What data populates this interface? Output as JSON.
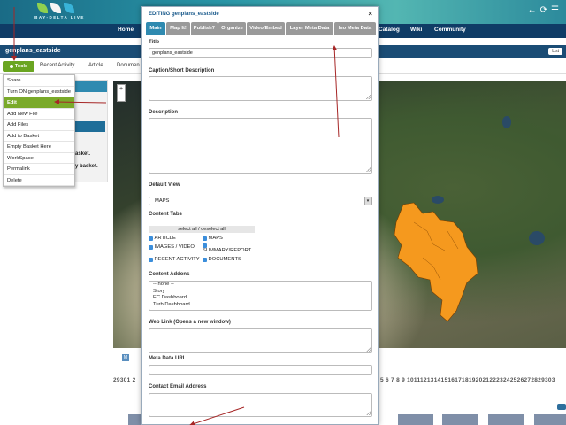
{
  "header": {
    "logo_text": "BAY-DELTA LIVE",
    "icons": [
      "back-arrow-icon",
      "refresh-icon",
      "menu-icon"
    ]
  },
  "nav": {
    "items": [
      "Home",
      "Catalog",
      "Wiki",
      "Community"
    ]
  },
  "page": {
    "title": "genplans_eastside",
    "list_label": "List"
  },
  "tabs": {
    "tools_label": "Tools",
    "items": [
      "Recent Activity",
      "Article",
      "Documen"
    ]
  },
  "tools_menu": {
    "items": [
      "Share",
      "Turn ON genplans_eastside",
      "Edit",
      "Add New File",
      "Add Files",
      "Add to Basket",
      "Empty Basket Here",
      "WorkSpace",
      "Permalink",
      "Delete"
    ],
    "active_index": 2
  },
  "left_panel": {
    "text1": "asket.",
    "text2": "y basket."
  },
  "modal": {
    "title": "EDITING genplans_eastside",
    "close_label": "×",
    "tabs": [
      "Main",
      "Map It!",
      "Publish?",
      "Organize",
      "Video/Embed",
      "Layer Meta Data",
      "Iso Meta Data"
    ],
    "active_tab": 0,
    "fields": {
      "title_label": "Title",
      "title_value": "genplans_eastside",
      "caption_label": "Caption/Short Description",
      "description_label": "Description",
      "default_view_label": "Default View",
      "default_view_value": "MAPS",
      "content_tabs_label": "Content Tabs",
      "select_all_label": "select all / deselect all",
      "content_tabs": [
        "ARTICLE",
        "MAPS",
        "IMAGES / VIDEO",
        "SUMMARY/REPORT",
        "RECENT ACTIVITY",
        "DOCUMENTS"
      ],
      "content_addons_label": "Content Addons",
      "addons": [
        "-- none --",
        "Story",
        "EC Dashboard",
        "Turb Dashboard"
      ],
      "web_link_label": "Web Link (Opens a new window)",
      "meta_url_label": "Meta Data URL",
      "contact_email_label": "Contact Email Address"
    }
  },
  "lower": {
    "m_badge": "M",
    "numbers_left": "29301 2",
    "numbers_right": "5 6 7 8 9 1011121314151617181920212223242526272829303"
  },
  "colors": {
    "nav_bg": "#0f3c66",
    "title_bg": "#1a4c75",
    "tools_green": "#6aa521",
    "active_tab": "#2f8ab0",
    "arrow_red": "#a62626",
    "shape_orange": "#f5991e"
  }
}
